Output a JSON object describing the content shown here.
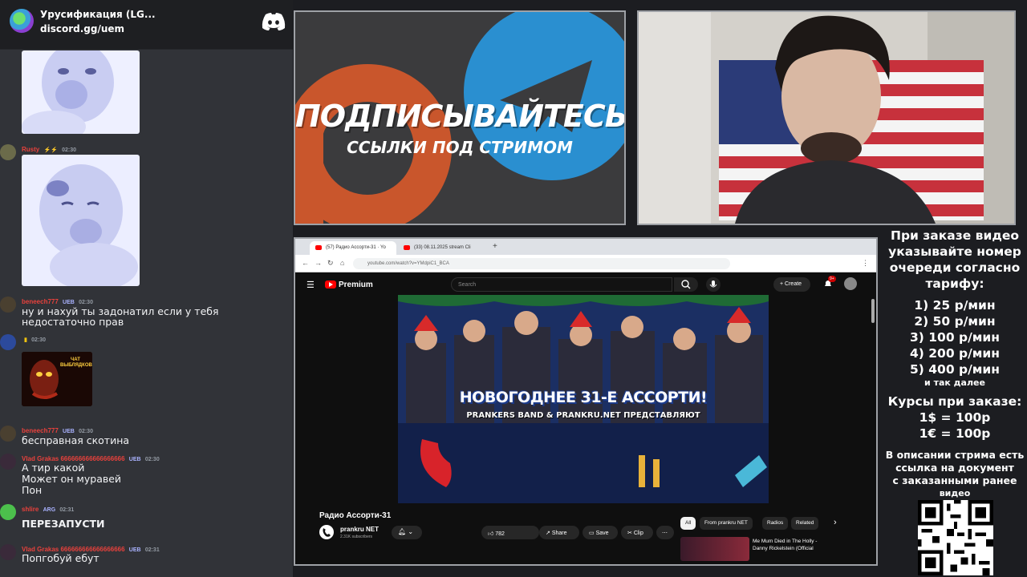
{
  "discord": {
    "server_name": "Урусификация (LG...",
    "invite_link": "discord.gg/uem",
    "messages": [
      {
        "user": "Rusty",
        "badge": "",
        "time": "02:30",
        "color": "#e8413c",
        "text": ""
      },
      {
        "user": "beneech777",
        "badge": "UEB",
        "time": "02:30",
        "color": "#e8413c",
        "text": "ну и нахуй ты задонатил если у тебя недостаточно прав"
      },
      {
        "user": "",
        "badge": "",
        "time": "02:30",
        "color": "#f1c40f",
        "text": ""
      },
      {
        "user": "beneech777",
        "badge": "UEB",
        "time": "02:30",
        "color": "#e8413c",
        "text": "бесправная скотина"
      },
      {
        "user": "Vlad Grakas 666666666666666666",
        "badge": "UEB",
        "time": "02:30",
        "color": "#e8413c",
        "lines": [
          "А тир какой",
          "Может он муравей",
          "Пон"
        ]
      },
      {
        "user": "shlire",
        "badge": "ARG",
        "time": "02:31",
        "color": "#e8413c",
        "text": "ПЕРЕЗАПУСТИ"
      },
      {
        "user": "Vlad Grakas 666666666666666666",
        "badge": "UEB",
        "time": "02:31",
        "color": "#e8413c",
        "text": "Попгобуй ебут"
      }
    ],
    "sticker_text": "ЧАТ ВЫБЛЯДКОВ"
  },
  "banner": {
    "title": "ПОДПИСЫВАЙТЕСЬ",
    "subtitle": "ССЫЛКИ ПОД СТРИМОМ"
  },
  "browser": {
    "tabs": [
      "(57) Радио Ассорти-31 · Yo",
      "(33) 08.11.2025 stream Cli"
    ],
    "url": "youtube.com/watch?v=YMdpiC1_BCA",
    "yt_brand": "Premium",
    "search_placeholder": "Search",
    "create_label": "Create",
    "notif_count": "9+",
    "video_title_overlay": "НОВОГОДНЕЕ 31-Е АССОРТИ!",
    "video_subtitle_overlay": "PRANKERS BAND & PRANKRU.NET ПРЕДСТАВЛЯЮТ",
    "video_title": "Радио Ассорти-31",
    "channel": "prankru NET",
    "subscribers": "2.31K subscribers",
    "likes": "782",
    "share_label": "Share",
    "save_label": "Save",
    "clip_label": "Clip",
    "chips": [
      "All",
      "From prankru NET",
      "Radios",
      "Related"
    ],
    "rec_title": "Me Mum Died in The Holly - Danny Rickelstein (Official"
  },
  "prices": {
    "header": [
      "При заказе видео",
      "указывайте номер",
      "очереди согласно",
      "тарифу:"
    ],
    "tiers": [
      "1) 25 р/мин",
      "2) 50 р/мин",
      "3) 100 р/мин",
      "4) 200 р/мин",
      "5) 400 р/мин"
    ],
    "etc": "и так далее",
    "rates_title": "Курсы при заказе:",
    "rates": [
      "1$ = 100р",
      "1€ = 100р"
    ],
    "note": [
      "В описании стрима есть",
      "ссылка на документ",
      "с заказанными ранее",
      "видео"
    ]
  },
  "colors": {
    "discord_bg": "#313338",
    "youtube_red": "#ff0000",
    "telegram_blue": "#2a9fd8",
    "patreon_orange": "#e85b2b"
  }
}
